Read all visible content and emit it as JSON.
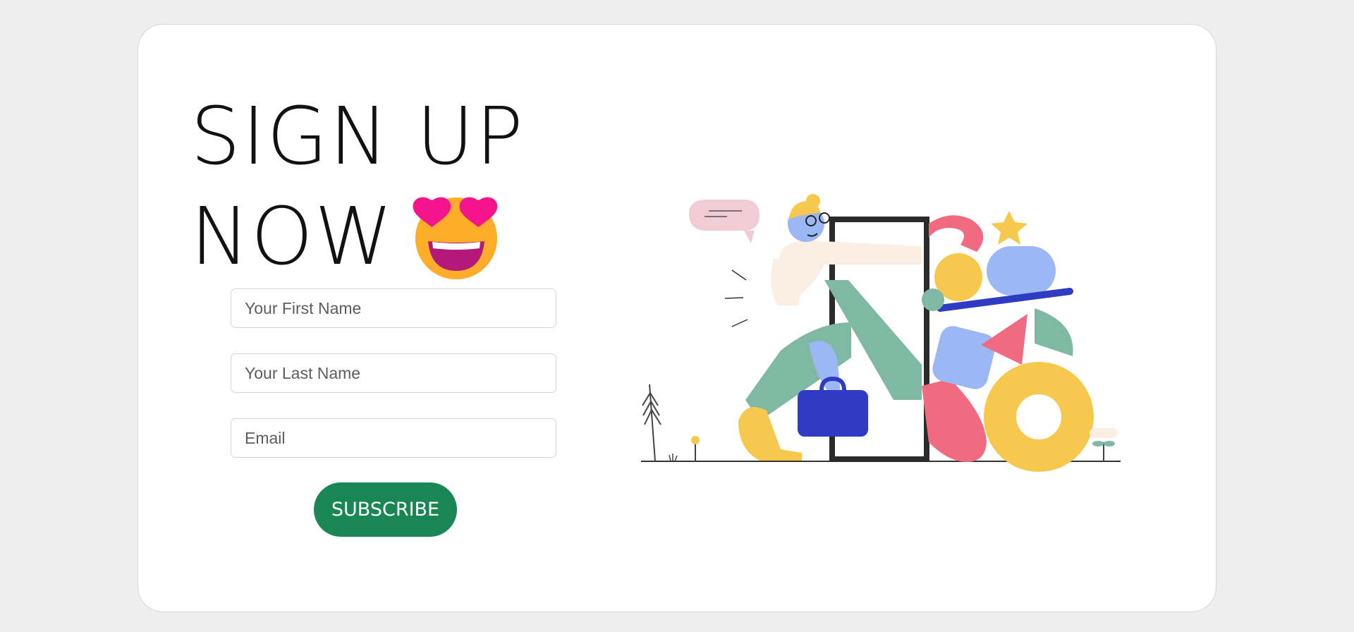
{
  "headline": {
    "line1": "SIGN UP",
    "line2": "NOW"
  },
  "form": {
    "first_name_placeholder": "Your First Name",
    "last_name_placeholder": "Your Last Name",
    "email_placeholder": "Email",
    "subscribe_label": "SUBSCRIBE"
  },
  "emoji": "heart-eyes-grinning-emoji",
  "illustration": "person-walking-through-door-with-shapes",
  "colors": {
    "page_bg": "#eeeeee",
    "card_bg": "#ffffff",
    "button": "#198754",
    "button_text": "#ffffff",
    "heading": "#111111"
  }
}
